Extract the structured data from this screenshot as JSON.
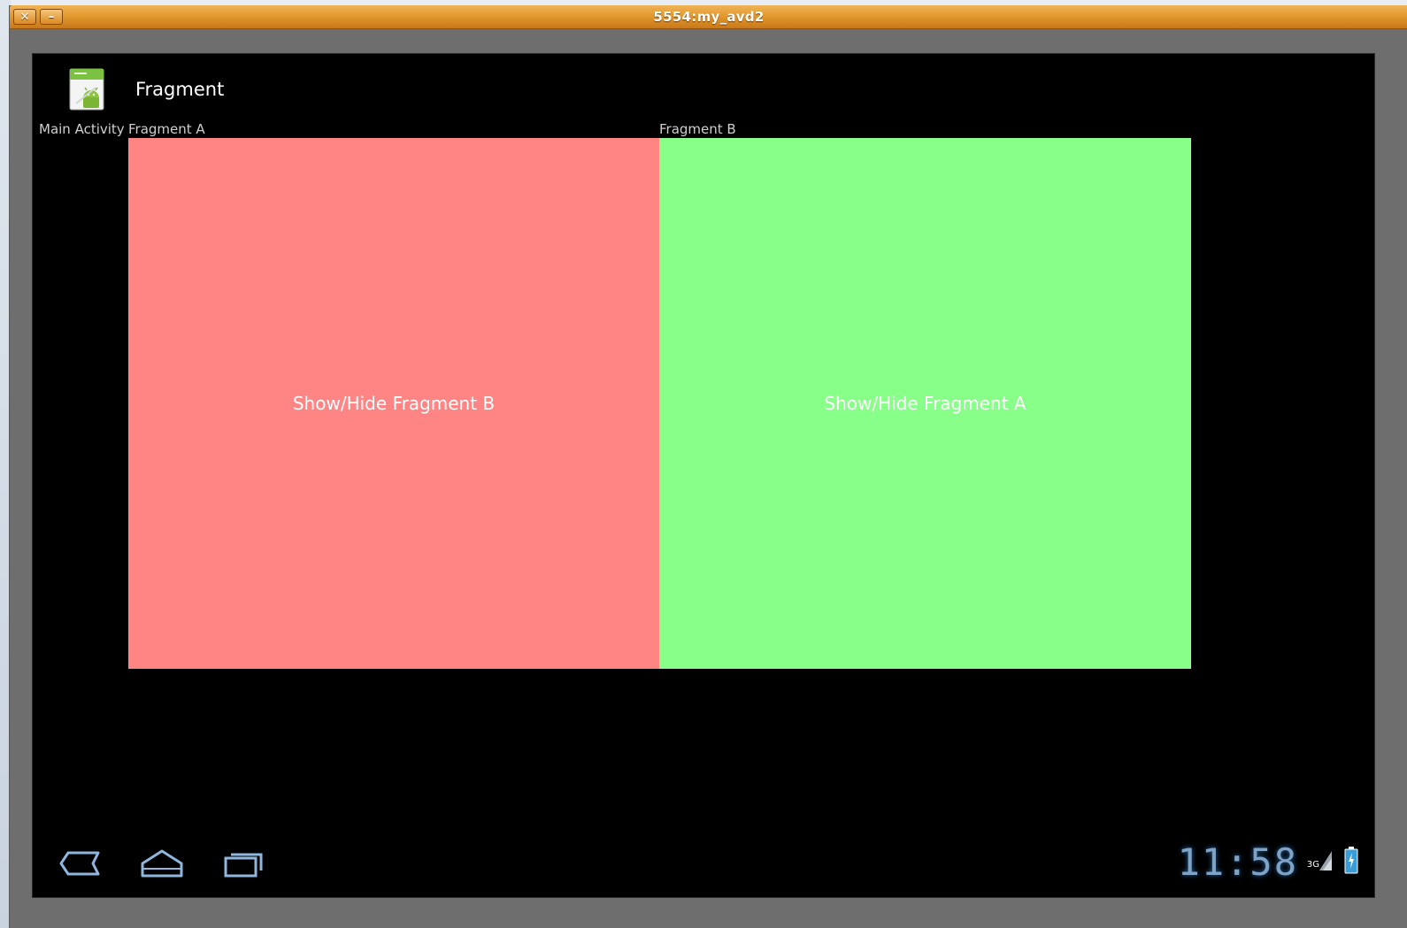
{
  "window": {
    "title": "5554:my_avd2",
    "close_glyph": "✕",
    "minimize_glyph": "–"
  },
  "action_bar": {
    "title": "Fragment",
    "icon": "android-app-icon"
  },
  "labels": {
    "main_activity": "Main Activity",
    "fragment_a": "Fragment A",
    "fragment_b": "Fragment B"
  },
  "fragments": {
    "a": {
      "button_text": "Show/Hide Fragment B",
      "color": "#ff8585"
    },
    "b": {
      "button_text": "Show/Hide Fragment A",
      "color": "#88ff88"
    }
  },
  "system_bar": {
    "time": "11:58",
    "network": "3G",
    "icons": [
      "back-icon",
      "home-icon",
      "recent-apps-icon",
      "signal-icon",
      "battery-icon"
    ]
  },
  "colors": {
    "titlebar": "#e39a2e",
    "screen_background": "#000000",
    "clock": "#7fa3c6"
  }
}
